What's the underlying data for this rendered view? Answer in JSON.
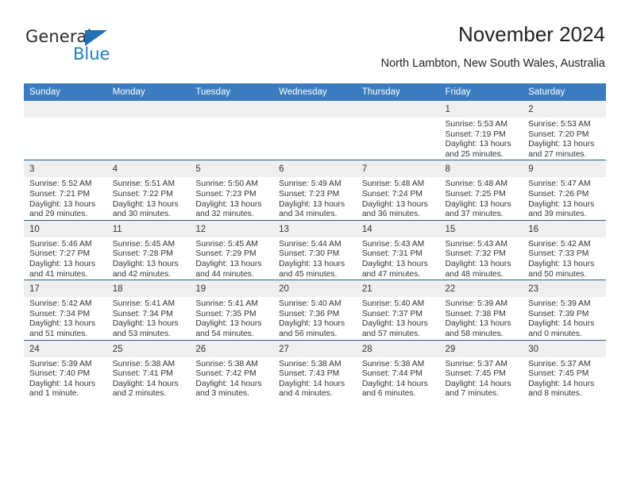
{
  "brand": {
    "name_top": "General",
    "name_bottom": "Blue",
    "accent_color": "#1f7fc4",
    "triangle_color": "#1f71b8"
  },
  "header": {
    "title": "November 2024",
    "subtitle": "North Lambton, New South Wales, Australia"
  },
  "calendar": {
    "header_bg": "#3a7cbf",
    "daynum_bg": "#efefef",
    "row_rule_color": "#2b5f8e",
    "weekday_headers": [
      "Sunday",
      "Monday",
      "Tuesday",
      "Wednesday",
      "Thursday",
      "Friday",
      "Saturday"
    ],
    "weeks": [
      [
        {
          "day": "",
          "empty": true
        },
        {
          "day": "",
          "empty": true
        },
        {
          "day": "",
          "empty": true
        },
        {
          "day": "",
          "empty": true
        },
        {
          "day": "",
          "empty": true
        },
        {
          "day": "1",
          "sunrise": "Sunrise: 5:53 AM",
          "sunset": "Sunset: 7:19 PM",
          "daylight": "Daylight: 13 hours and 25 minutes."
        },
        {
          "day": "2",
          "sunrise": "Sunrise: 5:53 AM",
          "sunset": "Sunset: 7:20 PM",
          "daylight": "Daylight: 13 hours and 27 minutes."
        }
      ],
      [
        {
          "day": "3",
          "sunrise": "Sunrise: 5:52 AM",
          "sunset": "Sunset: 7:21 PM",
          "daylight": "Daylight: 13 hours and 29 minutes."
        },
        {
          "day": "4",
          "sunrise": "Sunrise: 5:51 AM",
          "sunset": "Sunset: 7:22 PM",
          "daylight": "Daylight: 13 hours and 30 minutes."
        },
        {
          "day": "5",
          "sunrise": "Sunrise: 5:50 AM",
          "sunset": "Sunset: 7:23 PM",
          "daylight": "Daylight: 13 hours and 32 minutes."
        },
        {
          "day": "6",
          "sunrise": "Sunrise: 5:49 AM",
          "sunset": "Sunset: 7:23 PM",
          "daylight": "Daylight: 13 hours and 34 minutes."
        },
        {
          "day": "7",
          "sunrise": "Sunrise: 5:48 AM",
          "sunset": "Sunset: 7:24 PM",
          "daylight": "Daylight: 13 hours and 36 minutes."
        },
        {
          "day": "8",
          "sunrise": "Sunrise: 5:48 AM",
          "sunset": "Sunset: 7:25 PM",
          "daylight": "Daylight: 13 hours and 37 minutes."
        },
        {
          "day": "9",
          "sunrise": "Sunrise: 5:47 AM",
          "sunset": "Sunset: 7:26 PM",
          "daylight": "Daylight: 13 hours and 39 minutes."
        }
      ],
      [
        {
          "day": "10",
          "sunrise": "Sunrise: 5:46 AM",
          "sunset": "Sunset: 7:27 PM",
          "daylight": "Daylight: 13 hours and 41 minutes."
        },
        {
          "day": "11",
          "sunrise": "Sunrise: 5:45 AM",
          "sunset": "Sunset: 7:28 PM",
          "daylight": "Daylight: 13 hours and 42 minutes."
        },
        {
          "day": "12",
          "sunrise": "Sunrise: 5:45 AM",
          "sunset": "Sunset: 7:29 PM",
          "daylight": "Daylight: 13 hours and 44 minutes."
        },
        {
          "day": "13",
          "sunrise": "Sunrise: 5:44 AM",
          "sunset": "Sunset: 7:30 PM",
          "daylight": "Daylight: 13 hours and 45 minutes."
        },
        {
          "day": "14",
          "sunrise": "Sunrise: 5:43 AM",
          "sunset": "Sunset: 7:31 PM",
          "daylight": "Daylight: 13 hours and 47 minutes."
        },
        {
          "day": "15",
          "sunrise": "Sunrise: 5:43 AM",
          "sunset": "Sunset: 7:32 PM",
          "daylight": "Daylight: 13 hours and 48 minutes."
        },
        {
          "day": "16",
          "sunrise": "Sunrise: 5:42 AM",
          "sunset": "Sunset: 7:33 PM",
          "daylight": "Daylight: 13 hours and 50 minutes."
        }
      ],
      [
        {
          "day": "17",
          "sunrise": "Sunrise: 5:42 AM",
          "sunset": "Sunset: 7:34 PM",
          "daylight": "Daylight: 13 hours and 51 minutes."
        },
        {
          "day": "18",
          "sunrise": "Sunrise: 5:41 AM",
          "sunset": "Sunset: 7:34 PM",
          "daylight": "Daylight: 13 hours and 53 minutes."
        },
        {
          "day": "19",
          "sunrise": "Sunrise: 5:41 AM",
          "sunset": "Sunset: 7:35 PM",
          "daylight": "Daylight: 13 hours and 54 minutes."
        },
        {
          "day": "20",
          "sunrise": "Sunrise: 5:40 AM",
          "sunset": "Sunset: 7:36 PM",
          "daylight": "Daylight: 13 hours and 56 minutes."
        },
        {
          "day": "21",
          "sunrise": "Sunrise: 5:40 AM",
          "sunset": "Sunset: 7:37 PM",
          "daylight": "Daylight: 13 hours and 57 minutes."
        },
        {
          "day": "22",
          "sunrise": "Sunrise: 5:39 AM",
          "sunset": "Sunset: 7:38 PM",
          "daylight": "Daylight: 13 hours and 58 minutes."
        },
        {
          "day": "23",
          "sunrise": "Sunrise: 5:39 AM",
          "sunset": "Sunset: 7:39 PM",
          "daylight": "Daylight: 14 hours and 0 minutes."
        }
      ],
      [
        {
          "day": "24",
          "sunrise": "Sunrise: 5:39 AM",
          "sunset": "Sunset: 7:40 PM",
          "daylight": "Daylight: 14 hours and 1 minute."
        },
        {
          "day": "25",
          "sunrise": "Sunrise: 5:38 AM",
          "sunset": "Sunset: 7:41 PM",
          "daylight": "Daylight: 14 hours and 2 minutes."
        },
        {
          "day": "26",
          "sunrise": "Sunrise: 5:38 AM",
          "sunset": "Sunset: 7:42 PM",
          "daylight": "Daylight: 14 hours and 3 minutes."
        },
        {
          "day": "27",
          "sunrise": "Sunrise: 5:38 AM",
          "sunset": "Sunset: 7:43 PM",
          "daylight": "Daylight: 14 hours and 4 minutes."
        },
        {
          "day": "28",
          "sunrise": "Sunrise: 5:38 AM",
          "sunset": "Sunset: 7:44 PM",
          "daylight": "Daylight: 14 hours and 6 minutes."
        },
        {
          "day": "29",
          "sunrise": "Sunrise: 5:37 AM",
          "sunset": "Sunset: 7:45 PM",
          "daylight": "Daylight: 14 hours and 7 minutes."
        },
        {
          "day": "30",
          "sunrise": "Sunrise: 5:37 AM",
          "sunset": "Sunset: 7:45 PM",
          "daylight": "Daylight: 14 hours and 8 minutes."
        }
      ]
    ]
  }
}
